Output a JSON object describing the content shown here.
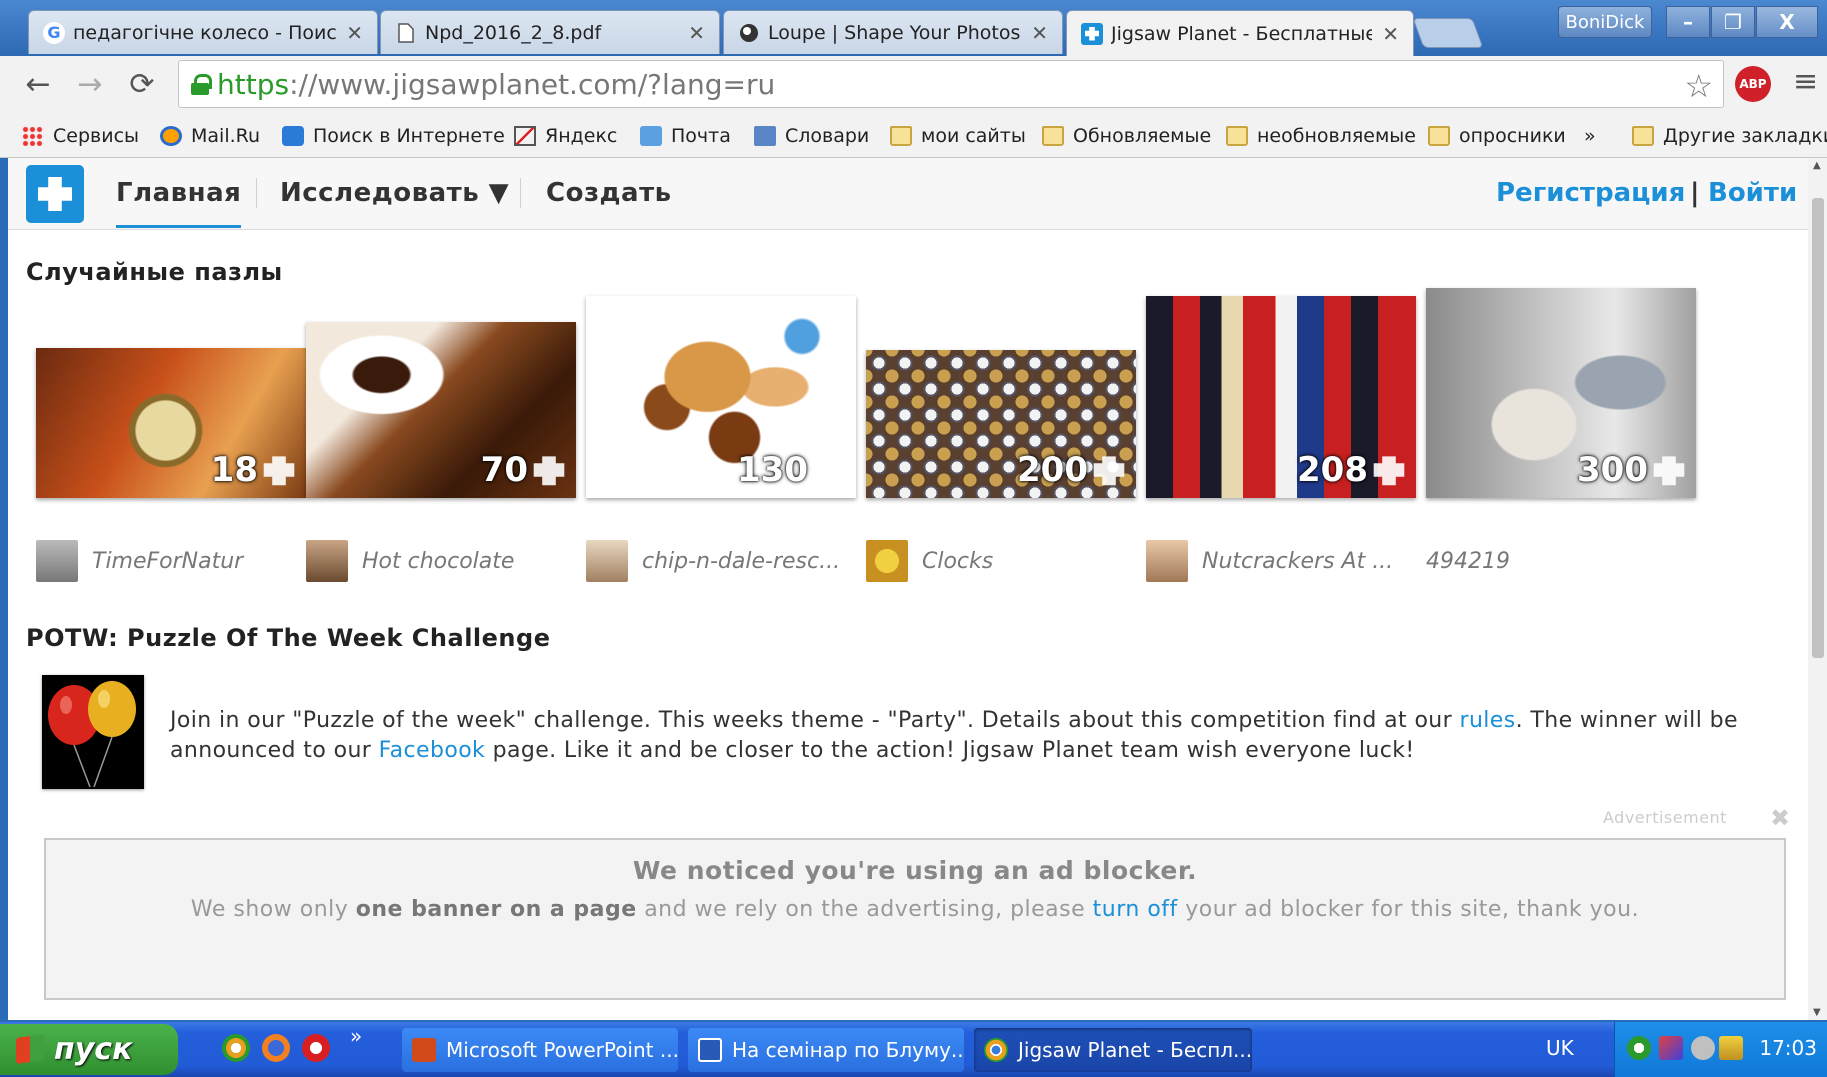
{
  "browser": {
    "tabs": [
      {
        "favicon": "G",
        "title": "педагогічне колесо - Поиск",
        "close": "✕"
      },
      {
        "favicon": "doc-icon",
        "title": "Npd_2016_2_8.pdf",
        "close": "✕"
      },
      {
        "favicon": "loupe-icon",
        "title": "Loupe | Shape Your Photos",
        "close": "✕"
      },
      {
        "favicon": "jigsaw-icon",
        "title": "Jigsaw Planet - Бесплатные",
        "close": "✕"
      }
    ],
    "user": "BoniDick",
    "window_buttons": [
      "–",
      "❐",
      "X"
    ],
    "url_scheme": "https",
    "url_rest": "://www.jigsawplanet.com/?lang=ru",
    "abp_label": "ABP",
    "bookmarks": [
      {
        "icon": "apps-icon",
        "label": "Сервисы"
      },
      {
        "icon": "mailru-icon",
        "label": "Mail.Ru"
      },
      {
        "icon": "search-icon",
        "label": "Поиск в Интернете"
      },
      {
        "icon": "yandex-icon",
        "label": "Яндекс"
      },
      {
        "icon": "mail-icon",
        "label": "Почта"
      },
      {
        "icon": "dictionary-icon",
        "label": "Словари"
      },
      {
        "icon": "folder-icon",
        "label": "мои сайты"
      },
      {
        "icon": "folder-icon",
        "label": "Обновляемые"
      },
      {
        "icon": "folder-icon",
        "label": "необновляемые"
      },
      {
        "icon": "folder-icon",
        "label": "опросники"
      },
      {
        "icon": "chevron-icon",
        "label": "»"
      },
      {
        "icon": "folder-icon",
        "label": "Другие закладки"
      }
    ]
  },
  "site": {
    "nav": {
      "home": "Главная",
      "explore": "Исследовать ▼",
      "create": "Создать",
      "register": "Регистрация",
      "separator": "|",
      "login": "Войти"
    },
    "random_title": "Случайные пазлы",
    "puzzles": [
      {
        "pieces": "18",
        "author": "TimeForNatur",
        "theme": "pocket-watch"
      },
      {
        "pieces": "70",
        "author": "Hot chocolate",
        "theme": "hot-chocolate"
      },
      {
        "pieces": "130",
        "author": "chip-n-dale-resc...",
        "theme": "cartoon"
      },
      {
        "pieces": "200",
        "author": "Clocks",
        "theme": "clocks"
      },
      {
        "pieces": "208",
        "author": "Nutcrackers At ...",
        "theme": "nutcrackers"
      },
      {
        "pieces": "300",
        "author": "494219",
        "theme": "couple"
      }
    ],
    "potw": {
      "title": "POTW: Puzzle Of The Week Challenge",
      "text_1": "Join in our \"Puzzle of the week\" challenge. This weeks theme - \"Party\". Details about this competition find at our ",
      "rules_link": "rules",
      "text_2": ". The winner will be announced to our ",
      "facebook_link": "Facebook",
      "text_3": " page. Like it and be closer to the action! Jigsaw Planet team wish everyone luck!"
    },
    "ad": {
      "label": "Advertisement",
      "heading": "We noticed you're using an ad blocker.",
      "text_1": "We show only ",
      "text_bold": "one banner on a page",
      "text_2": " and we rely on the advertising, please ",
      "turn_off_link": "turn off",
      "text_3": " your ad blocker for this site, thank you."
    }
  },
  "taskbar": {
    "start": "пуск",
    "more": "»",
    "tasks": [
      {
        "label": "Microsoft PowerPoint ...",
        "icon": "powerpoint-icon",
        "active": false
      },
      {
        "label": "На семінар по Блуму...",
        "icon": "word-icon",
        "active": false
      },
      {
        "label": "Jigsaw Planet - Беспл...",
        "icon": "chrome-icon",
        "active": true
      }
    ],
    "lang": "UK",
    "clock": "17:03"
  },
  "colors": {
    "accent": "#1b8fd8",
    "taskbar": "#245edb",
    "start": "#3a9d3a"
  }
}
